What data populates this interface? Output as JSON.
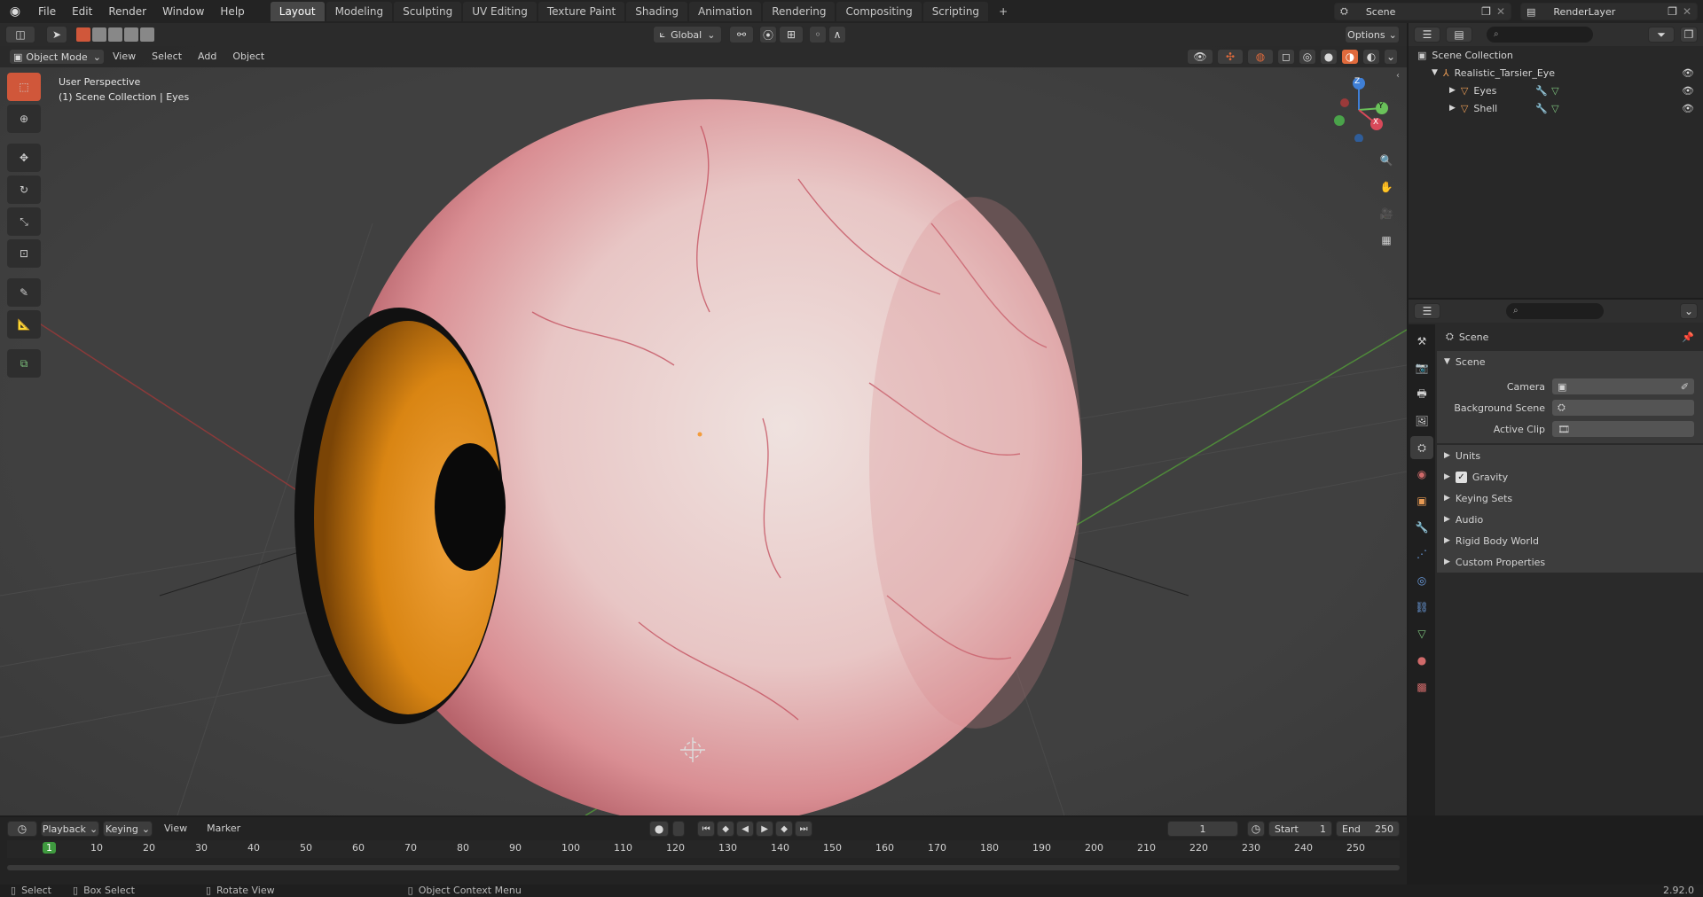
{
  "app": {
    "version": "2.92.0"
  },
  "menu": {
    "items": [
      "File",
      "Edit",
      "Render",
      "Window",
      "Help"
    ]
  },
  "workspaces": {
    "tabs": [
      "Layout",
      "Modeling",
      "Sculpting",
      "UV Editing",
      "Texture Paint",
      "Shading",
      "Animation",
      "Rendering",
      "Compositing",
      "Scripting"
    ],
    "active": "Layout"
  },
  "scene": {
    "name": "Scene",
    "render_layer": "RenderLayer"
  },
  "viewport_header": {
    "mode": "Object Mode",
    "menus": [
      "View",
      "Select",
      "Add",
      "Object"
    ],
    "transform": "Global",
    "options": "Options"
  },
  "viewport": {
    "perspective": "User Perspective",
    "collection": "(1) Scene Collection | Eyes"
  },
  "gizmo": {
    "z": "Z",
    "y": "Y",
    "x": "X"
  },
  "outliner": {
    "root": "Scene Collection",
    "items": [
      {
        "label": "Realistic_Tarsier_Eye"
      },
      {
        "label": "Eyes"
      },
      {
        "label": "Shell"
      }
    ]
  },
  "properties": {
    "breadcrumb": "Scene",
    "panel_title": "Scene",
    "fields": [
      {
        "label": "Camera"
      },
      {
        "label": "Background Scene"
      },
      {
        "label": "Active Clip"
      }
    ],
    "sections": [
      {
        "label": "Units"
      },
      {
        "label": "Gravity",
        "checkbox": true
      },
      {
        "label": "Keying Sets"
      },
      {
        "label": "Audio"
      },
      {
        "label": "Rigid Body World"
      },
      {
        "label": "Custom Properties"
      }
    ]
  },
  "timeline": {
    "menus": [
      "Playback",
      "Keying",
      "View",
      "Marker"
    ],
    "current_frame": "1",
    "start_label": "Start",
    "start": "1",
    "end_label": "End",
    "end": "250",
    "ticks": [
      "1",
      "10",
      "20",
      "30",
      "40",
      "50",
      "60",
      "70",
      "80",
      "90",
      "100",
      "110",
      "120",
      "130",
      "140",
      "150",
      "160",
      "170",
      "180",
      "190",
      "200",
      "210",
      "220",
      "230",
      "240",
      "250"
    ]
  },
  "statusbar": {
    "select": "Select",
    "box_select": "Box Select",
    "rotate": "Rotate View",
    "context": "Object Context Menu"
  },
  "colors": {
    "accent": "#5680c2",
    "header": "#232323",
    "viewport": "#3d3d3d",
    "iris": "#d98513"
  }
}
